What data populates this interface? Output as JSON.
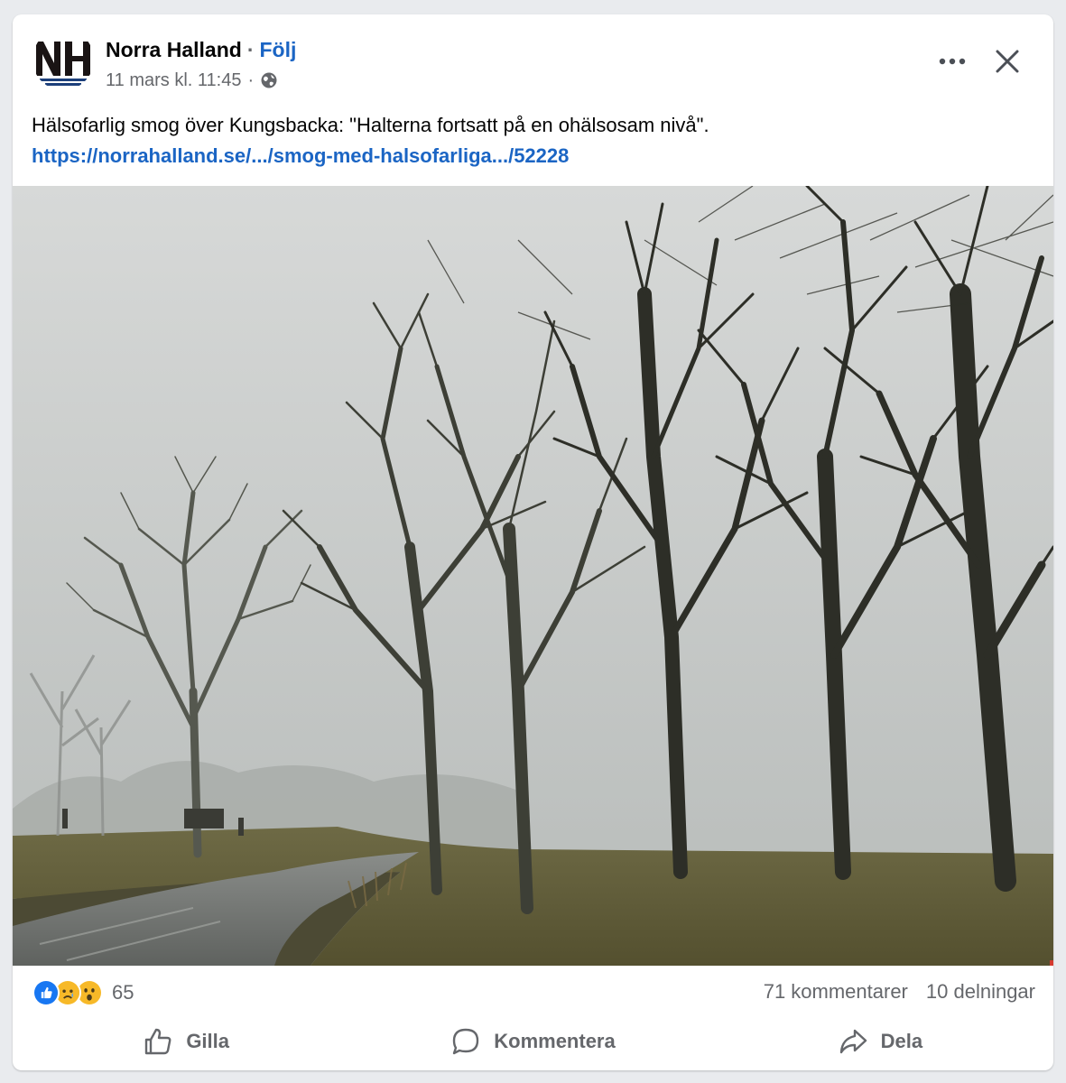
{
  "post": {
    "page_name": "Norra Halland",
    "separator": "·",
    "follow_label": "Följ",
    "timestamp": "11 mars kl. 11:45",
    "meta_separator": "·",
    "audience_icon": "globe-icon",
    "text": "Hälsofarlig smog över Kungsbacka: \"Halterna fortsatt på en ohälsosam nivå\".",
    "link": "https://norrahalland.se/.../smog-med-halsofarliga.../52228",
    "avatar_text": "NH"
  },
  "header_actions": {
    "more_icon": "more-horizontal-icon",
    "close_icon": "close-icon"
  },
  "stats": {
    "reactions": [
      "like-reaction-icon",
      "sad-reaction-icon",
      "wow-reaction-icon"
    ],
    "reaction_count": "65",
    "comments": "71 kommentarer",
    "shares": "10 delningar"
  },
  "actions": [
    {
      "label": "Gilla",
      "icon": "thumbs-up-icon"
    },
    {
      "label": "Kommentera",
      "icon": "comment-icon"
    },
    {
      "label": "Dela",
      "icon": "share-icon"
    }
  ],
  "colors": {
    "link": "#1b65c4",
    "secondary_text": "#65676b",
    "like_blue": "#1877f2",
    "emoji_yellow": "#f7b928"
  }
}
